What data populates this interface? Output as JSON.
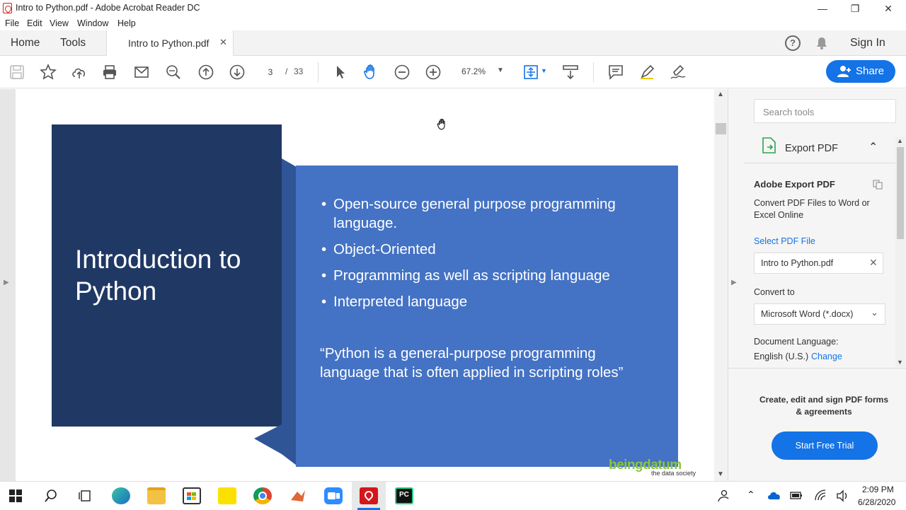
{
  "window": {
    "title": "Intro to Python.pdf - Adobe Acrobat Reader DC",
    "controls": {
      "minimize": "—",
      "restore": "❐",
      "close": "✕"
    }
  },
  "menu": [
    "File",
    "Edit",
    "View",
    "Window",
    "Help"
  ],
  "tabs": {
    "home": "Home",
    "tools": "Tools",
    "document": "Intro to Python.pdf",
    "sign_in": "Sign In"
  },
  "toolbar": {
    "current_page": "3",
    "page_separator": "/",
    "total_pages": "33",
    "zoom": "67.2%",
    "share_label": "Share"
  },
  "slide": {
    "title": "Introduction to Python",
    "bullets": [
      "Open-source general purpose programming language.",
      "Object-Oriented",
      "Programming as well as scripting language",
      "Interpreted language"
    ],
    "quote": "“Python is a general-purpose programming language that is often applied in scripting roles”",
    "watermark_brand": "beingdatum",
    "watermark_tag": "the data society",
    "colors": {
      "dark": "#203864",
      "mid": "#2f5597",
      "light": "#4472c4"
    }
  },
  "right_pane": {
    "search_placeholder": "Search tools",
    "export_header": "Export PDF",
    "export_title": "Adobe Export PDF",
    "export_desc": "Convert PDF Files to Word or Excel Online",
    "select_file_link": "Select PDF File",
    "selected_file": "Intro to Python.pdf",
    "convert_to_label": "Convert to",
    "convert_to_value": "Microsoft Word (*.docx)",
    "doc_lang_label": "Document Language:",
    "doc_lang_value": "English (U.S.)",
    "change_link": "Change",
    "promo_text": "Create, edit and sign PDF forms & agreements",
    "trial_button": "Start Free Trial"
  },
  "taskbar": {
    "time": "2:09 PM",
    "date": "6/28/2020",
    "apps": [
      "windows-start",
      "search",
      "task-view",
      "edge",
      "file-explorer",
      "store",
      "sticky-notes",
      "chrome",
      "matlab",
      "zoom",
      "acrobat",
      "pycharm"
    ]
  }
}
